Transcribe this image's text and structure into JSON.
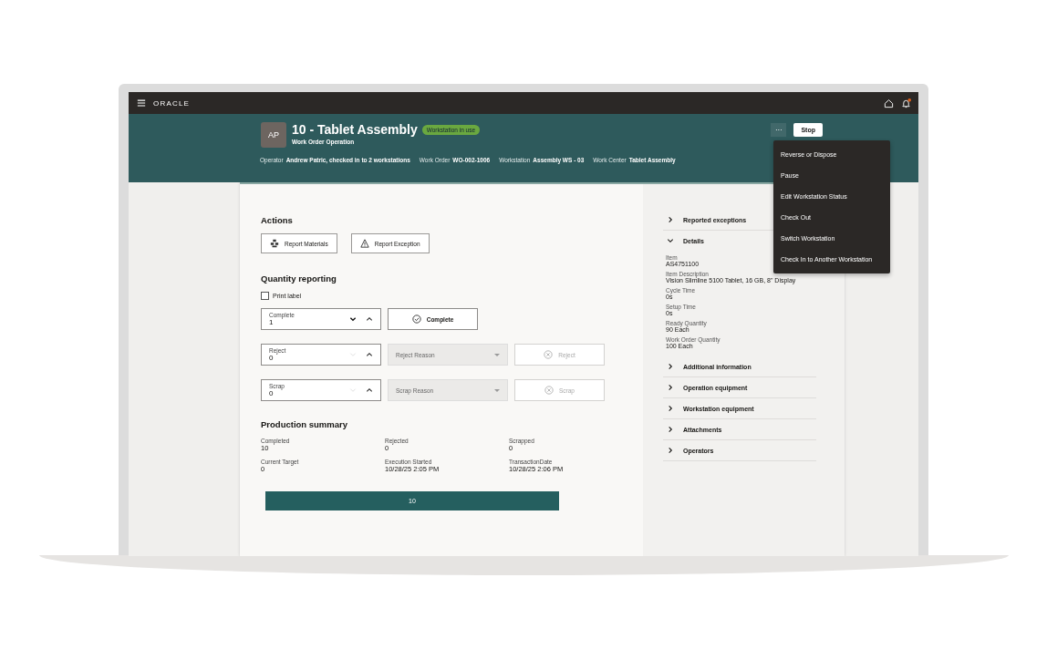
{
  "top_bar": {
    "logo": "ORACLE"
  },
  "header": {
    "avatar": "AP",
    "title": "10 - Tablet Assembly",
    "badge": "Workstation in use",
    "subtitle": "Work Order Operation",
    "meta": [
      {
        "label": "Operator",
        "value": "Andrew Patric, checked in to 2 workstations"
      },
      {
        "label": "Work Order",
        "value": "WO-002-1006"
      },
      {
        "label": "Workstation",
        "value": "Assembly WS - 03"
      },
      {
        "label": "Work Center",
        "value": "Tablet Assembly"
      }
    ],
    "more_button": "···",
    "stop_button": "Stop"
  },
  "menu": {
    "items": [
      "Reverse or Dispose",
      "Pause",
      "Edit Workstation Status",
      "Check Out",
      "Switch Workstation",
      "Check In to Another Workstation"
    ]
  },
  "actions": {
    "title": "Actions",
    "buttons": [
      {
        "kind": "materials",
        "label": "Report Materials"
      },
      {
        "kind": "exception",
        "label": "Report Exception"
      }
    ]
  },
  "quantity_reporting": {
    "title": "Quantity reporting",
    "print_label": {
      "label": "Print label",
      "checked": false
    },
    "rows": [
      {
        "label": "Complete",
        "value": "1",
        "decrement_disabled": false,
        "action": {
          "kind": "check",
          "label": "Complete",
          "disabled": false
        }
      },
      {
        "label": "Reject",
        "value": "0",
        "decrement_disabled": true,
        "reason": {
          "placeholder": "Reject Reason",
          "disabled": true
        },
        "action": {
          "kind": "cross",
          "label": "Reject",
          "disabled": true
        }
      },
      {
        "label": "Scrap",
        "value": "0",
        "decrement_disabled": true,
        "reason": {
          "placeholder": "Scrap Reason",
          "disabled": true
        },
        "action": {
          "kind": "cross",
          "label": "Scrap",
          "disabled": true
        }
      }
    ]
  },
  "production_summary": {
    "title": "Production summary",
    "fields": [
      {
        "label": "Completed",
        "value": "10"
      },
      {
        "label": "Rejected",
        "value": "0"
      },
      {
        "label": "Scrapped",
        "value": "0"
      },
      {
        "label": "Current Target",
        "value": "0"
      },
      {
        "label": "Execution Started",
        "value": "10/28/25 2:05 PM"
      },
      {
        "label": "TransactionDate",
        "value": "10/28/25 2:06 PM"
      }
    ],
    "bar": {
      "label": "10"
    }
  },
  "side_panel": {
    "sections": [
      {
        "title": "Reported exceptions",
        "expanded": false
      },
      {
        "title": "Details",
        "expanded": true,
        "fields": [
          {
            "label": "Item",
            "value": "AS4751100"
          },
          {
            "label": "Item Description",
            "value": "Vision Slimline 5100 Tablet, 16 GB, 8\" Display"
          },
          {
            "label": "Cycle Time",
            "value": "0s"
          },
          {
            "label": "Setup Time",
            "value": "0s"
          },
          {
            "label": "Ready Quantity",
            "value": "90 Each"
          },
          {
            "label": "Work Order Quantity",
            "value": "100 Each"
          }
        ]
      },
      {
        "title": "Additional information",
        "expanded": false
      },
      {
        "title": "Operation equipment",
        "expanded": false
      },
      {
        "title": "Workstation equipment",
        "expanded": false
      },
      {
        "title": "Attachments",
        "expanded": false
      },
      {
        "title": "Operators",
        "expanded": false
      }
    ]
  }
}
